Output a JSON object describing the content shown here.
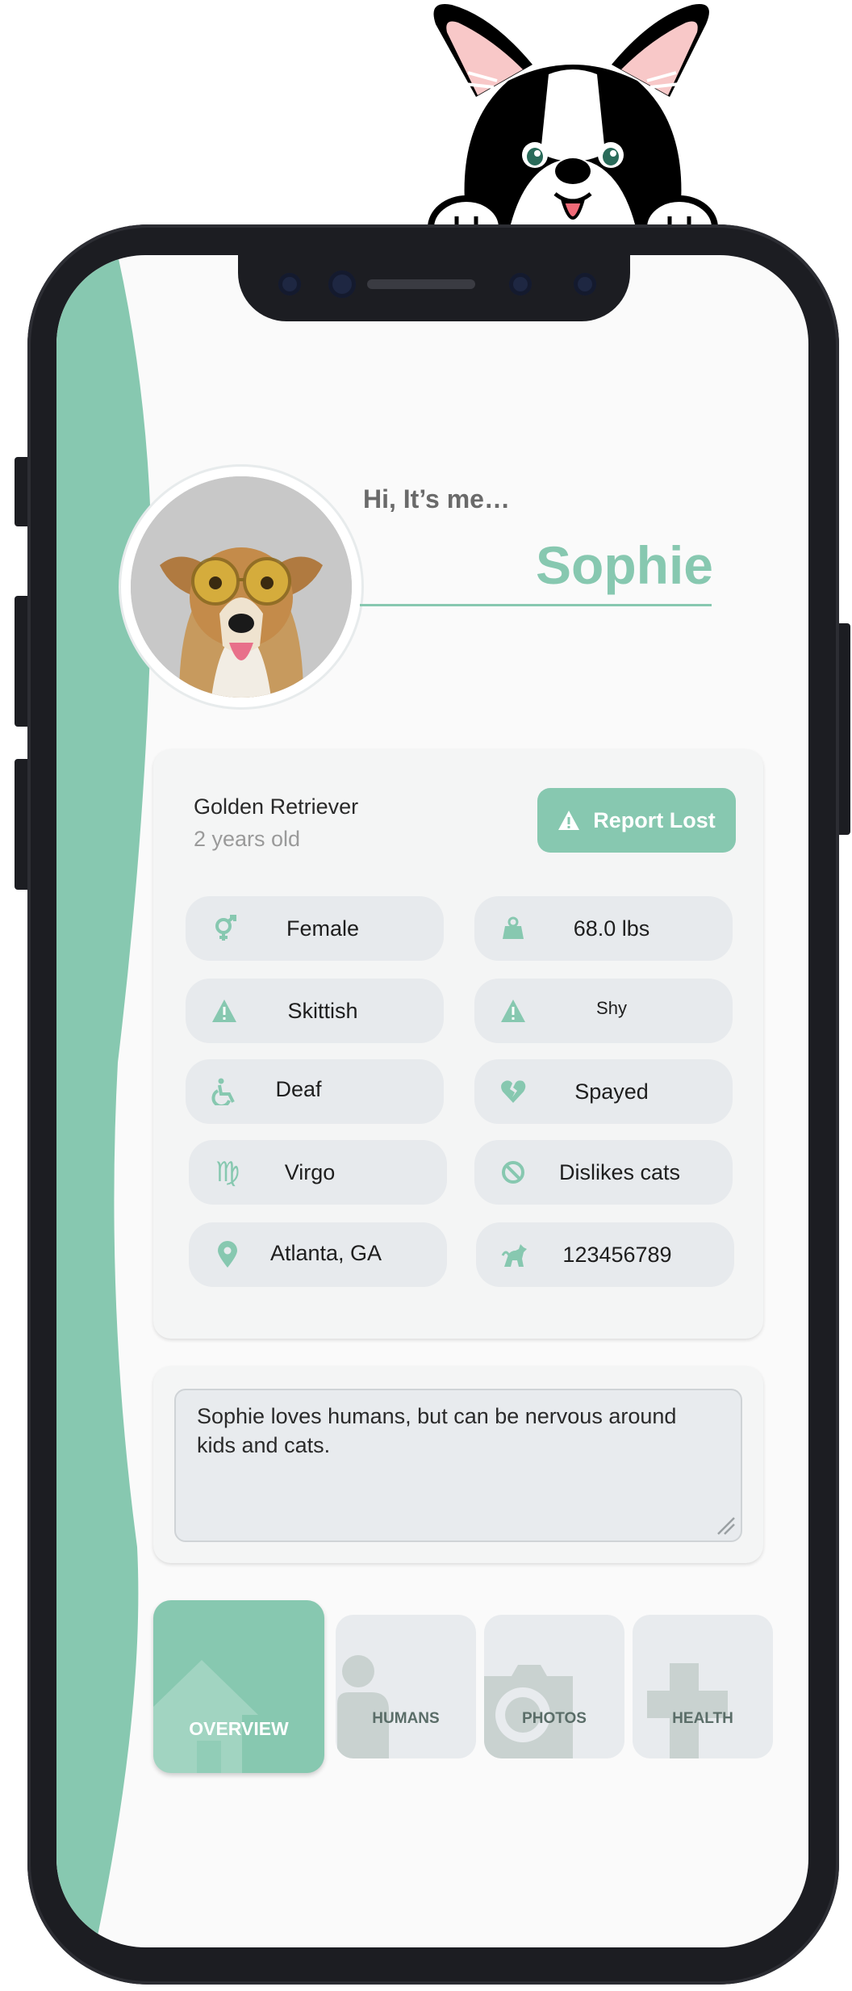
{
  "profile": {
    "greeting": "Hi, It’s me…",
    "name": "Sophie",
    "breed": "Golden Retriever",
    "age": "2 years old",
    "report_button": "Report Lost"
  },
  "attributes": [
    {
      "icon": "gender-icon",
      "label": "Female"
    },
    {
      "icon": "weight-icon",
      "label": "68.0 lbs"
    },
    {
      "icon": "warning-icon",
      "label": "Skittish"
    },
    {
      "icon": "warning-icon",
      "label": "Shy"
    },
    {
      "icon": "wheelchair-icon",
      "label": "Deaf"
    },
    {
      "icon": "broken-heart-icon",
      "label": "Spayed"
    },
    {
      "icon": "virgo-icon",
      "label": "Virgo"
    },
    {
      "icon": "ban-icon",
      "label": "Dislikes cats"
    },
    {
      "icon": "location-pin-icon",
      "label": "Atlanta, GA"
    },
    {
      "icon": "pets-icon",
      "label": "123456789"
    }
  ],
  "notes": "Sophie loves humans,  but can be nervous around kids and cats.",
  "tabs": [
    {
      "label": "OVERVIEW",
      "icon": "home-icon",
      "active": true
    },
    {
      "label": "HUMANS",
      "icon": "person-icon",
      "active": false
    },
    {
      "label": "PHOTOS",
      "icon": "camera-icon",
      "active": false
    },
    {
      "label": "HEALTH",
      "icon": "medical-cross-icon",
      "active": false
    }
  ],
  "colors": {
    "accent": "#87c8b0",
    "pill_bg": "#e7eaed",
    "frame": "#1c1d22"
  }
}
